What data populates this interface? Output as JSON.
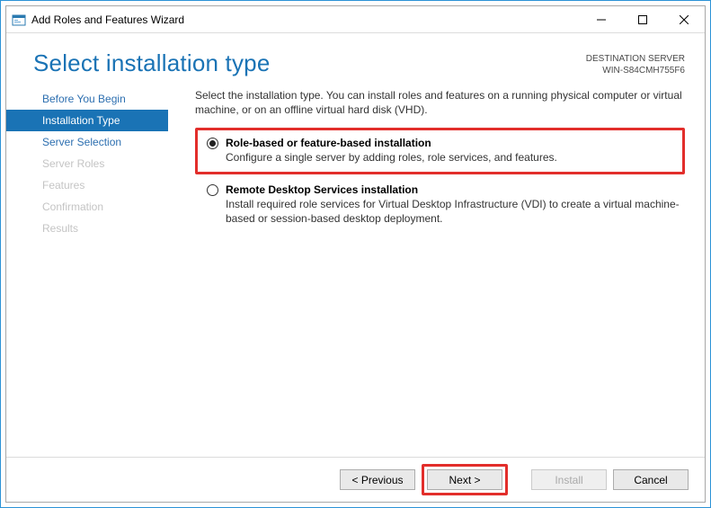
{
  "titlebar": {
    "title": "Add Roles and Features Wizard"
  },
  "header": {
    "page_title": "Select installation type",
    "dest_label": "DESTINATION SERVER",
    "dest_server": "WIN-S84CMH755F6"
  },
  "sidebar": {
    "items": [
      {
        "label": "Before You Begin",
        "state": "enabled"
      },
      {
        "label": "Installation Type",
        "state": "selected"
      },
      {
        "label": "Server Selection",
        "state": "enabled"
      },
      {
        "label": "Server Roles",
        "state": "disabled"
      },
      {
        "label": "Features",
        "state": "disabled"
      },
      {
        "label": "Confirmation",
        "state": "disabled"
      },
      {
        "label": "Results",
        "state": "disabled"
      }
    ]
  },
  "content": {
    "intro": "Select the installation type. You can install roles and features on a running physical computer or virtual machine, or on an offline virtual hard disk (VHD).",
    "options": [
      {
        "title": "Role-based or feature-based installation",
        "desc": "Configure a single server by adding roles, role services, and features.",
        "selected": true,
        "highlighted": true
      },
      {
        "title": "Remote Desktop Services installation",
        "desc": "Install required role services for Virtual Desktop Infrastructure (VDI) to create a virtual machine-based or session-based desktop deployment.",
        "selected": false,
        "highlighted": false
      }
    ]
  },
  "footer": {
    "previous": "< Previous",
    "next": "Next >",
    "install": "Install",
    "cancel": "Cancel"
  }
}
